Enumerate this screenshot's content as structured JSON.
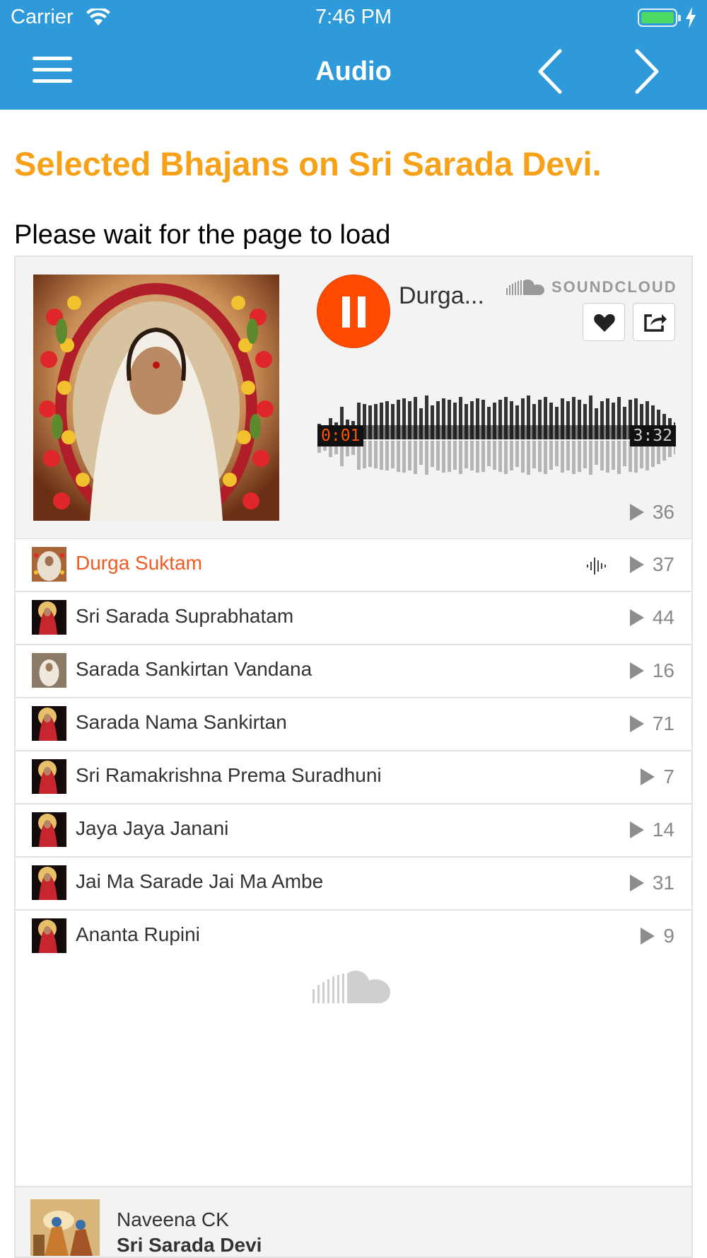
{
  "status_bar": {
    "carrier": "Carrier",
    "time": "7:46 PM",
    "battery_level": 1.0
  },
  "nav": {
    "title": "Audio",
    "menu_icon": "hamburger-menu-icon",
    "back_icon": "chevron-left-icon",
    "forward_icon": "chevron-right-icon"
  },
  "page": {
    "heading": "Selected Bhajans on Sri Sarada Devi.",
    "wait_text": "Please wait for the page to load"
  },
  "player": {
    "now_playing": "Durga...",
    "brand": "SOUNDCLOUD",
    "current_time": "0:01",
    "total_time": "3:32",
    "plays": "36",
    "state": "playing",
    "progress": 0.005
  },
  "tracks": [
    {
      "title": "Durga Suktam",
      "plays": "37",
      "active": true
    },
    {
      "title": "Sri Sarada Suprabhatam",
      "plays": "44",
      "active": false
    },
    {
      "title": "Sarada Sankirtan Vandana",
      "plays": "16",
      "active": false
    },
    {
      "title": "Sarada Nama Sankirtan",
      "plays": "71",
      "active": false
    },
    {
      "title": "Sri Ramakrishna Prema Suradhuni",
      "plays": "7",
      "active": false
    },
    {
      "title": "Jaya Jaya Janani",
      "plays": "14",
      "active": false
    },
    {
      "title": "Jai Ma Sarade Jai Ma Ambe",
      "plays": "31",
      "active": false
    },
    {
      "title": "Ananta Rupini",
      "plays": "9",
      "active": false
    }
  ],
  "footer": {
    "user": "Naveena CK",
    "playlist": "Sri Sarada Devi"
  },
  "colors": {
    "nav_bar": "#2e9ad9",
    "heading": "#f7a118",
    "soundcloud_orange": "#ff5500",
    "active_track": "#f15a22"
  }
}
